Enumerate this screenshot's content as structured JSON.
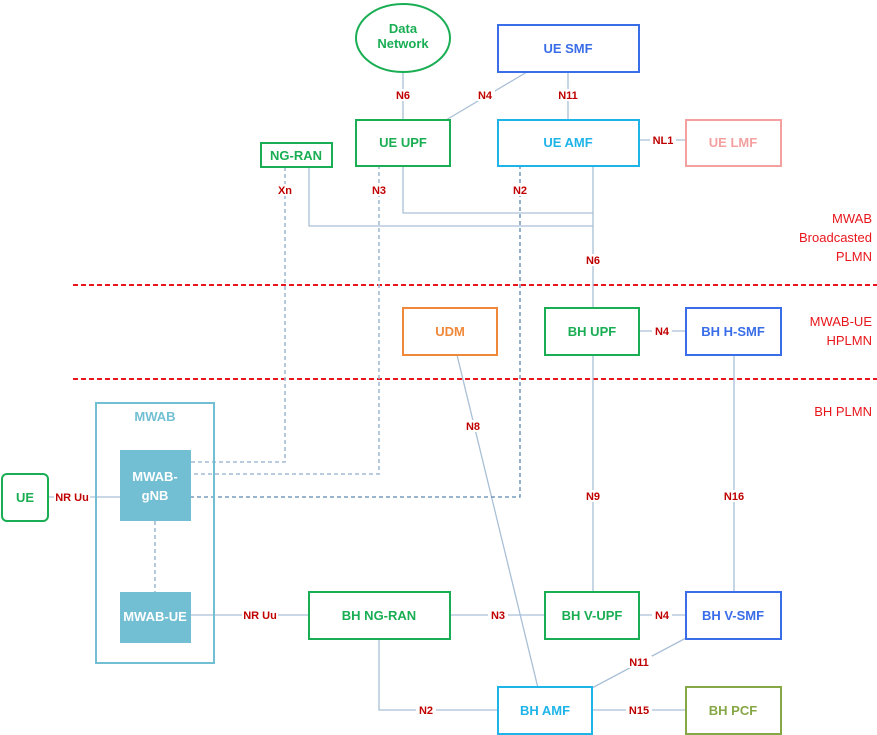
{
  "zones": {
    "top": [
      "MWAB",
      "Broadcasted",
      "PLMN"
    ],
    "middle": [
      "MWAB-UE",
      "HPLMN"
    ],
    "bottom": [
      "BH PLMN"
    ]
  },
  "nodes": {
    "data_network": [
      "Data",
      "Network"
    ],
    "ue_smf": "UE SMF",
    "ue_upf": "UE UPF",
    "ue_amf": "UE AMF",
    "ue_lmf": "UE LMF",
    "ng_ran": "NG-RAN",
    "udm": "UDM",
    "bh_upf": "BH UPF",
    "bh_h_smf": "BH H-SMF",
    "mwab": "MWAB",
    "mwab_gnb": [
      "MWAB-",
      "gNB"
    ],
    "mwab_ue": "MWAB-UE",
    "ue": "UE",
    "bh_ng_ran": "BH NG-RAN",
    "bh_v_upf": "BH V-UPF",
    "bh_v_smf": "BH V-SMF",
    "bh_amf": "BH AMF",
    "bh_pcf": "BH PCF"
  },
  "interfaces": {
    "n6_dn": "N6",
    "n4_top": "N4",
    "n11_top": "N11",
    "nl1": "NL1",
    "xn": "Xn",
    "n3_top": "N3",
    "n2_top": "N2",
    "n6_mid": "N6",
    "n4_mid": "N4",
    "n8": "N8",
    "n9": "N9",
    "n16": "N16",
    "nr_uu_ue": "NR Uu",
    "nr_uu_mwab": "NR Uu",
    "n3_bottom": "N3",
    "n4_bottom": "N4",
    "n11_bottom": "N11",
    "n2_bottom": "N2",
    "n15": "N15"
  },
  "colors": {
    "green": "#1aae54",
    "blue": "#3a6ee8",
    "cyan": "#1fb4e8",
    "pink": "#f4a0a0",
    "orange": "#f0883a",
    "olive": "#86a745",
    "teal": "#72bfd3",
    "red": "#e8161c",
    "label": "#c00000"
  }
}
